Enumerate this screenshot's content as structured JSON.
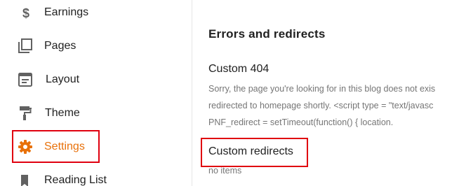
{
  "sidebar": {
    "items": [
      {
        "label": "Earnings",
        "icon": "dollar-icon"
      },
      {
        "label": "Pages",
        "icon": "pages-icon"
      },
      {
        "label": "Layout",
        "icon": "layout-icon"
      },
      {
        "label": "Theme",
        "icon": "paint-roller-icon"
      },
      {
        "label": "Settings",
        "icon": "gear-icon",
        "active": true
      },
      {
        "label": "Reading List",
        "icon": "bookmark-icon"
      }
    ]
  },
  "main": {
    "section_title": "Errors and redirects",
    "custom_404": {
      "title": "Custom 404",
      "description_lines": [
        "Sorry, the page you're looking for in this blog does not exis",
        "redirected to homepage shortly. <script type = \"text/javasc",
        "PNF_redirect = setTimeout(function() { location."
      ]
    },
    "custom_redirects": {
      "title": "Custom redirects",
      "description": "no items"
    }
  },
  "colors": {
    "accent": "#e8710a",
    "highlight": "#e0000f",
    "icon": "#616161",
    "text": "#212121",
    "muted": "#757575"
  }
}
